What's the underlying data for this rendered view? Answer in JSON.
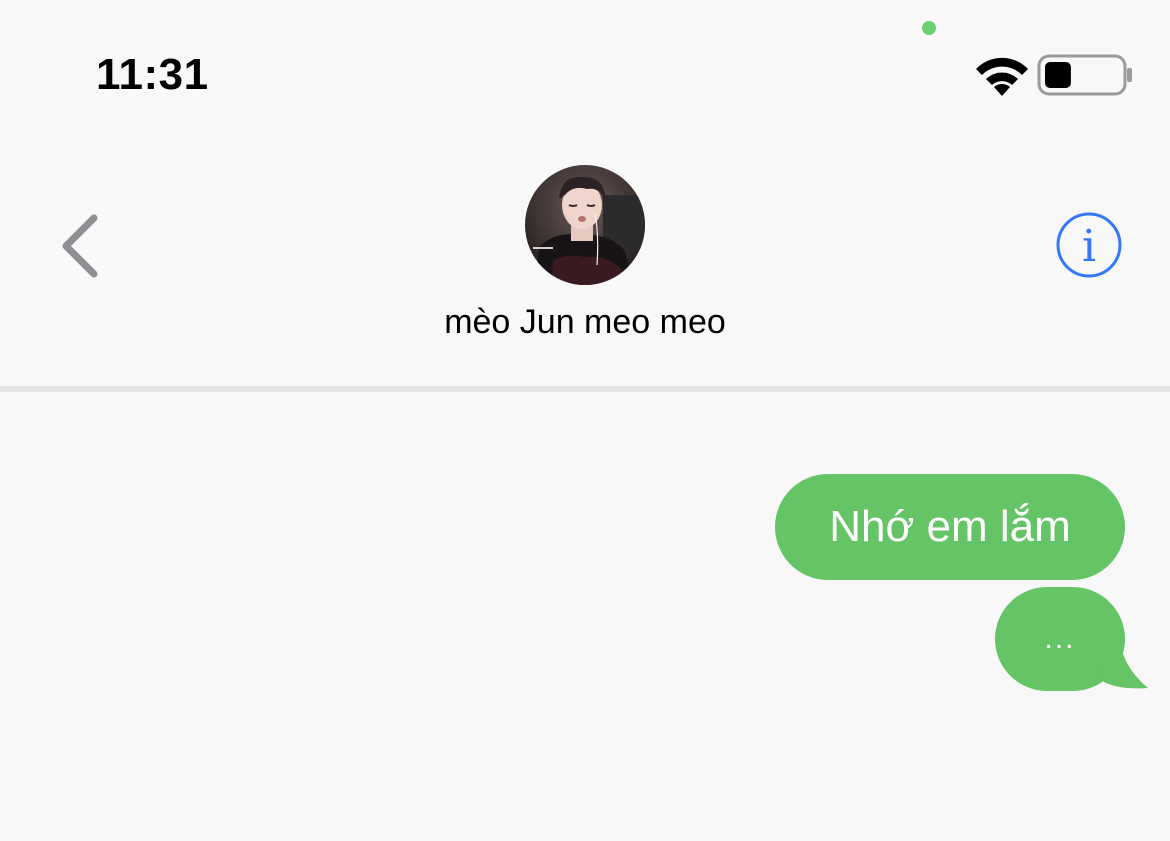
{
  "status_bar": {
    "time": "11:31",
    "wifi_icon": "wifi-icon",
    "battery_icon": "battery-icon",
    "battery_level": 0.35,
    "camera_indicator_color": "#6fcf73"
  },
  "header": {
    "back_icon": "chevron-left-icon",
    "contact_name": "mèo Jun meo meo",
    "avatar": "contact-avatar",
    "info_icon": "info-icon"
  },
  "messages": [
    {
      "direction": "outgoing",
      "text": "Nhớ em lắm"
    },
    {
      "direction": "outgoing",
      "text": "..."
    }
  ],
  "colors": {
    "background": "#f8f8f8",
    "bubble_outgoing": "#65c466",
    "accent_info": "#3478f6",
    "back_chevron": "#8e8e93",
    "divider": "#e3e3e5"
  }
}
